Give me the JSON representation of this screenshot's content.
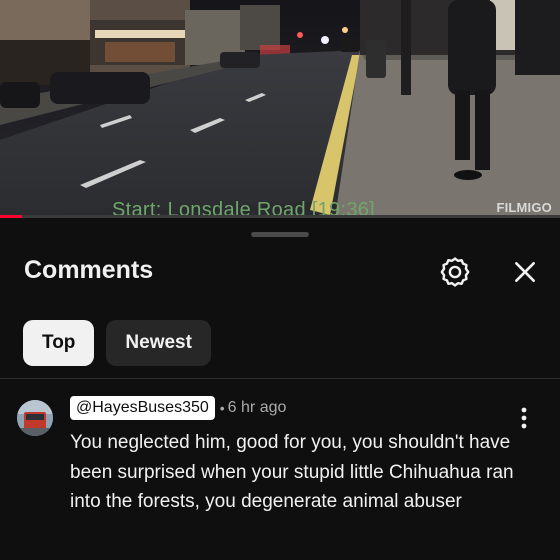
{
  "video": {
    "caption": "Start: Lonsdale Road [19:36]",
    "watermark": "FILMIGO",
    "progress_fraction": 0.04
  },
  "comments_panel": {
    "title": "Comments",
    "settings_icon": "gear-icon",
    "close_icon": "close-icon",
    "sort_chips": [
      {
        "label": "Top",
        "selected": true
      },
      {
        "label": "Newest",
        "selected": false
      }
    ]
  },
  "comment": {
    "author": "@HayesBuses350",
    "separator": "•",
    "time": "6 hr ago",
    "text": "You neglected him, good for you, you shouldn't have been surprised when your stupid little Chihuahua ran into the forests, you degenerate animal abuser",
    "more_icon": "more-vertical-icon"
  },
  "colors": {
    "background": "#0f0f0f",
    "chip_active": "#f1f1f1",
    "chip_inactive": "#272727",
    "caption_green": "#6fa66a",
    "progress_red": "#ff0033"
  }
}
